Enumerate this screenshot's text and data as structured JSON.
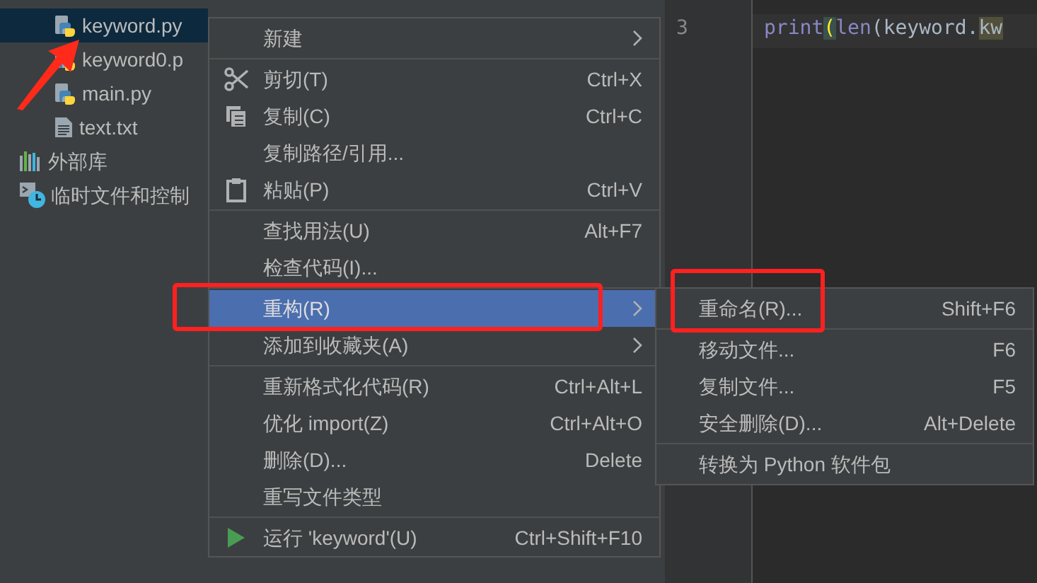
{
  "project_tree": {
    "items": [
      {
        "children": [
          {
            "kind": "python",
            "label": "keyword.py",
            "selected": true
          },
          {
            "kind": "python",
            "label": "keyword0.p",
            "selected": false
          },
          {
            "kind": "python",
            "label": "main.py",
            "selected": false
          },
          {
            "kind": "text",
            "label": "text.txt",
            "selected": false
          }
        ]
      },
      {
        "kind": "library",
        "label": "外部库",
        "selected": false
      },
      {
        "kind": "scratch",
        "label": "临时文件和控制",
        "selected": false
      }
    ]
  },
  "editor": {
    "lines": [
      {
        "number": "3",
        "code": [
          {
            "kind": "builtin",
            "text": "print"
          },
          {
            "kind": "brace",
            "text": "("
          },
          {
            "kind": "builtin",
            "text": "len"
          },
          {
            "kind": "plain",
            "text": "(keyword."
          },
          {
            "kind": "match",
            "text": "kw"
          }
        ]
      }
    ]
  },
  "context_menu": {
    "items": [
      {
        "kind": "item",
        "label": "新建",
        "submenu": true,
        "selected": false
      },
      {
        "kind": "separator"
      },
      {
        "kind": "cut",
        "label": "剪切(T)",
        "shortcut": "Ctrl+X",
        "selected": false
      },
      {
        "kind": "copy",
        "label": "复制(C)",
        "shortcut": "Ctrl+C",
        "selected": false
      },
      {
        "kind": "item",
        "label": "复制路径/引用...",
        "selected": false
      },
      {
        "kind": "paste",
        "label": "粘贴(P)",
        "shortcut": "Ctrl+V",
        "selected": false
      },
      {
        "kind": "separator"
      },
      {
        "kind": "item",
        "label": "查找用法(U)",
        "shortcut": "Alt+F7",
        "selected": false
      },
      {
        "kind": "item",
        "label": "检查代码(I)...",
        "selected": false
      },
      {
        "kind": "separator"
      },
      {
        "kind": "item",
        "label": "重构(R)",
        "submenu": true,
        "selected": true
      },
      {
        "kind": "item",
        "label": "添加到收藏夹(A)",
        "submenu": true,
        "selected": false
      },
      {
        "kind": "separator"
      },
      {
        "kind": "item",
        "label": "重新格式化代码(R)",
        "shortcut": "Ctrl+Alt+L",
        "selected": false
      },
      {
        "kind": "item",
        "label": "优化 import(Z)",
        "shortcut": "Ctrl+Alt+O",
        "selected": false
      },
      {
        "kind": "item",
        "label": "删除(D)...",
        "shortcut": "Delete",
        "selected": false
      },
      {
        "kind": "item",
        "label": "重写文件类型",
        "selected": false
      },
      {
        "kind": "separator"
      },
      {
        "kind": "run",
        "label": "运行 'keyword'(U)",
        "shortcut": "Ctrl+Shift+F10",
        "selected": false
      }
    ]
  },
  "submenu": {
    "items": [
      {
        "kind": "item",
        "label": "重命名(R)...",
        "shortcut": "Shift+F6"
      },
      {
        "kind": "separator"
      },
      {
        "kind": "item",
        "label": "移动文件...",
        "shortcut": "F6"
      },
      {
        "kind": "item",
        "label": "复制文件...",
        "shortcut": "F5"
      },
      {
        "kind": "item",
        "label": "安全删除(D)...",
        "shortcut": "Alt+Delete"
      },
      {
        "kind": "separator"
      },
      {
        "kind": "item",
        "label": "转换为 Python 软件包"
      }
    ]
  }
}
